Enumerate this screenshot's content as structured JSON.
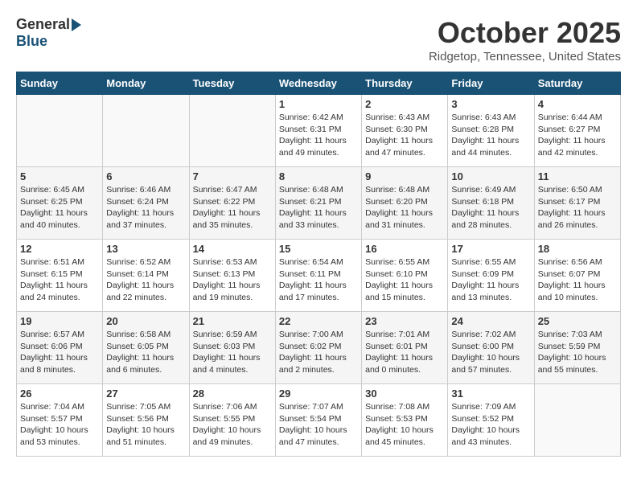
{
  "header": {
    "logo_general": "General",
    "logo_blue": "Blue",
    "month_title": "October 2025",
    "location": "Ridgetop, Tennessee, United States"
  },
  "weekdays": [
    "Sunday",
    "Monday",
    "Tuesday",
    "Wednesday",
    "Thursday",
    "Friday",
    "Saturday"
  ],
  "weeks": [
    [
      {
        "day": "",
        "info": ""
      },
      {
        "day": "",
        "info": ""
      },
      {
        "day": "",
        "info": ""
      },
      {
        "day": "1",
        "info": "Sunrise: 6:42 AM\nSunset: 6:31 PM\nDaylight: 11 hours\nand 49 minutes."
      },
      {
        "day": "2",
        "info": "Sunrise: 6:43 AM\nSunset: 6:30 PM\nDaylight: 11 hours\nand 47 minutes."
      },
      {
        "day": "3",
        "info": "Sunrise: 6:43 AM\nSunset: 6:28 PM\nDaylight: 11 hours\nand 44 minutes."
      },
      {
        "day": "4",
        "info": "Sunrise: 6:44 AM\nSunset: 6:27 PM\nDaylight: 11 hours\nand 42 minutes."
      }
    ],
    [
      {
        "day": "5",
        "info": "Sunrise: 6:45 AM\nSunset: 6:25 PM\nDaylight: 11 hours\nand 40 minutes."
      },
      {
        "day": "6",
        "info": "Sunrise: 6:46 AM\nSunset: 6:24 PM\nDaylight: 11 hours\nand 37 minutes."
      },
      {
        "day": "7",
        "info": "Sunrise: 6:47 AM\nSunset: 6:22 PM\nDaylight: 11 hours\nand 35 minutes."
      },
      {
        "day": "8",
        "info": "Sunrise: 6:48 AM\nSunset: 6:21 PM\nDaylight: 11 hours\nand 33 minutes."
      },
      {
        "day": "9",
        "info": "Sunrise: 6:48 AM\nSunset: 6:20 PM\nDaylight: 11 hours\nand 31 minutes."
      },
      {
        "day": "10",
        "info": "Sunrise: 6:49 AM\nSunset: 6:18 PM\nDaylight: 11 hours\nand 28 minutes."
      },
      {
        "day": "11",
        "info": "Sunrise: 6:50 AM\nSunset: 6:17 PM\nDaylight: 11 hours\nand 26 minutes."
      }
    ],
    [
      {
        "day": "12",
        "info": "Sunrise: 6:51 AM\nSunset: 6:15 PM\nDaylight: 11 hours\nand 24 minutes."
      },
      {
        "day": "13",
        "info": "Sunrise: 6:52 AM\nSunset: 6:14 PM\nDaylight: 11 hours\nand 22 minutes."
      },
      {
        "day": "14",
        "info": "Sunrise: 6:53 AM\nSunset: 6:13 PM\nDaylight: 11 hours\nand 19 minutes."
      },
      {
        "day": "15",
        "info": "Sunrise: 6:54 AM\nSunset: 6:11 PM\nDaylight: 11 hours\nand 17 minutes."
      },
      {
        "day": "16",
        "info": "Sunrise: 6:55 AM\nSunset: 6:10 PM\nDaylight: 11 hours\nand 15 minutes."
      },
      {
        "day": "17",
        "info": "Sunrise: 6:55 AM\nSunset: 6:09 PM\nDaylight: 11 hours\nand 13 minutes."
      },
      {
        "day": "18",
        "info": "Sunrise: 6:56 AM\nSunset: 6:07 PM\nDaylight: 11 hours\nand 10 minutes."
      }
    ],
    [
      {
        "day": "19",
        "info": "Sunrise: 6:57 AM\nSunset: 6:06 PM\nDaylight: 11 hours\nand 8 minutes."
      },
      {
        "day": "20",
        "info": "Sunrise: 6:58 AM\nSunset: 6:05 PM\nDaylight: 11 hours\nand 6 minutes."
      },
      {
        "day": "21",
        "info": "Sunrise: 6:59 AM\nSunset: 6:03 PM\nDaylight: 11 hours\nand 4 minutes."
      },
      {
        "day": "22",
        "info": "Sunrise: 7:00 AM\nSunset: 6:02 PM\nDaylight: 11 hours\nand 2 minutes."
      },
      {
        "day": "23",
        "info": "Sunrise: 7:01 AM\nSunset: 6:01 PM\nDaylight: 11 hours\nand 0 minutes."
      },
      {
        "day": "24",
        "info": "Sunrise: 7:02 AM\nSunset: 6:00 PM\nDaylight: 10 hours\nand 57 minutes."
      },
      {
        "day": "25",
        "info": "Sunrise: 7:03 AM\nSunset: 5:59 PM\nDaylight: 10 hours\nand 55 minutes."
      }
    ],
    [
      {
        "day": "26",
        "info": "Sunrise: 7:04 AM\nSunset: 5:57 PM\nDaylight: 10 hours\nand 53 minutes."
      },
      {
        "day": "27",
        "info": "Sunrise: 7:05 AM\nSunset: 5:56 PM\nDaylight: 10 hours\nand 51 minutes."
      },
      {
        "day": "28",
        "info": "Sunrise: 7:06 AM\nSunset: 5:55 PM\nDaylight: 10 hours\nand 49 minutes."
      },
      {
        "day": "29",
        "info": "Sunrise: 7:07 AM\nSunset: 5:54 PM\nDaylight: 10 hours\nand 47 minutes."
      },
      {
        "day": "30",
        "info": "Sunrise: 7:08 AM\nSunset: 5:53 PM\nDaylight: 10 hours\nand 45 minutes."
      },
      {
        "day": "31",
        "info": "Sunrise: 7:09 AM\nSunset: 5:52 PM\nDaylight: 10 hours\nand 43 minutes."
      },
      {
        "day": "",
        "info": ""
      }
    ]
  ]
}
